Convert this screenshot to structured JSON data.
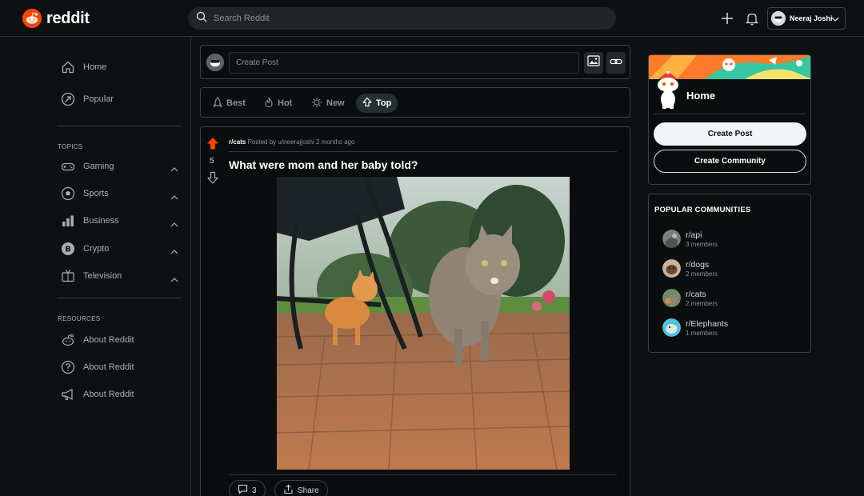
{
  "header": {
    "logo_text": "reddit",
    "search_placeholder": "Search Reddit",
    "user_name": "Neeraj Joshi"
  },
  "sidebar": {
    "top_items": [
      {
        "label": "Home",
        "icon": "home-icon"
      },
      {
        "label": "Popular",
        "icon": "popular-icon"
      }
    ],
    "topics_label": "TOPICS",
    "topics": [
      {
        "label": "Gaming",
        "icon": "gamepad-icon"
      },
      {
        "label": "Sports",
        "icon": "soccer-ball-icon"
      },
      {
        "label": "Business",
        "icon": "bar-chart-icon"
      },
      {
        "label": "Crypto",
        "icon": "bitcoin-icon"
      },
      {
        "label": "Television",
        "icon": "tv-icon"
      }
    ],
    "resources_label": "RESOURCES",
    "resources": [
      {
        "label": "About Reddit",
        "icon": "reddit-alien-icon"
      },
      {
        "label": "About Reddit",
        "icon": "help-icon"
      },
      {
        "label": "About Reddit",
        "icon": "megaphone-icon"
      }
    ]
  },
  "create_post": {
    "placeholder": "Create Post"
  },
  "sort": [
    {
      "label": "Best",
      "icon": "rocket-icon",
      "active": false
    },
    {
      "label": "Hot",
      "icon": "flame-icon",
      "active": false
    },
    {
      "label": "New",
      "icon": "sparkle-icon",
      "active": false
    },
    {
      "label": "Top",
      "icon": "top-arrow-icon",
      "active": true
    }
  ],
  "post": {
    "subreddit": "r/cats",
    "posted_by": "Posted by u/neerajjoshi 2 months ago",
    "title": "What were mom and her baby told?",
    "votes": "5",
    "comments": "3",
    "share_label": "Share"
  },
  "home_card": {
    "title": "Home",
    "create_post_label": "Create Post",
    "create_community_label": "Create Community"
  },
  "communities": {
    "header": "POPULAR COMMUNITIES",
    "items": [
      {
        "name": "r/api",
        "members": "3 members"
      },
      {
        "name": "r/dogs",
        "members": "2 members"
      },
      {
        "name": "r/cats",
        "members": "2 members"
      },
      {
        "name": "r/Elephants",
        "members": "1 members"
      }
    ]
  },
  "colors": {
    "brand": "#ff4500",
    "upvote": "#ff4500",
    "background": "#0e1113"
  }
}
